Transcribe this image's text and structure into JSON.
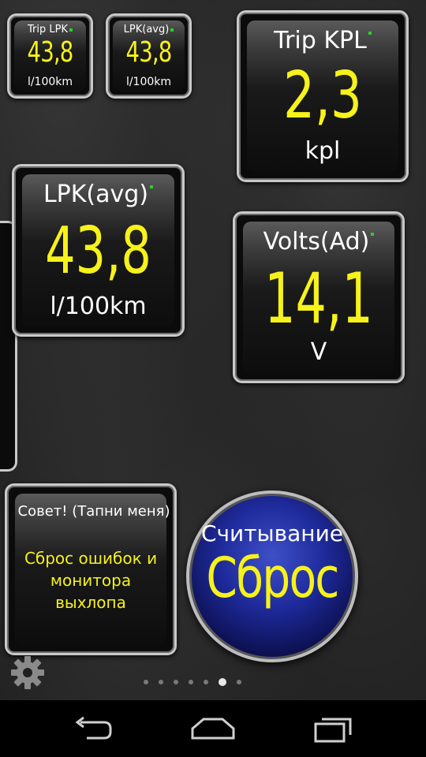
{
  "gauges": {
    "trip_lpk": {
      "label": "Trip LPK",
      "value": "43,8",
      "unit": "l/100km"
    },
    "lpk_avg_small": {
      "label": "LPK(avg)",
      "value": "43,8",
      "unit": "l/100km"
    },
    "trip_kpl": {
      "label": "Trip KPL",
      "value": "2,3",
      "unit": "kpl"
    },
    "lpk_avg": {
      "label": "LPK(avg)",
      "value": "43,8",
      "unit": "l/100km"
    },
    "volts": {
      "label": "Volts(Ad)",
      "value": "14,1",
      "unit": "V"
    }
  },
  "tip": {
    "title": "Совет! (Тапни меня)",
    "body_lines": [
      "Сброс ошибок и",
      "монитора",
      "выхлопа"
    ]
  },
  "reset_button": {
    "label": "Считывание",
    "value": "Сброс"
  },
  "pager": {
    "count": 7,
    "active_index": 5
  },
  "icons": {
    "settings": "gear-icon",
    "back": "back-icon",
    "home": "home-icon",
    "recents": "recents-icon"
  },
  "colors": {
    "value_yellow": "#f6f21a",
    "indicator_green": "#2ecc2e",
    "button_blue": "#1e2a9a"
  }
}
